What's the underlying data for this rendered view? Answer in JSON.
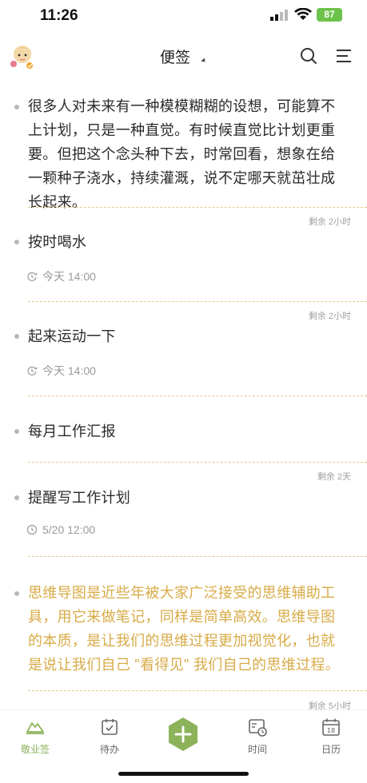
{
  "status_bar": {
    "time": "11:26",
    "battery": "87"
  },
  "header": {
    "title": "便签"
  },
  "notes": [
    {
      "text": "很多人对未来有一种模模糊糊的设想，可能算不上计划，只是一种直觉。有时候直觉比计划更重要。但把这个念头种下去，时常回看，想象在给一颗种子浇水，持续灌溉，说不定哪天就茁壮成长起来。",
      "remain": "剩余 2小时"
    },
    {
      "text": "按时喝水",
      "reminder": "今天 14:00",
      "remain": "剩余 2小时"
    },
    {
      "text": "起来运动一下",
      "reminder": "今天 14:00"
    },
    {
      "text": "每月工作汇报",
      "remain": "剩余 2天"
    },
    {
      "text": "提醒写工作计划",
      "reminder": "5/20 12:00"
    },
    {
      "text": "思维导图是近些年被大家广泛接受的思维辅助工具，用它来做笔记，同样是简单高效。思维导图的本质，是让我们的思维过程更加视觉化，也就是说让我们自己 \"看得见\" 我们自己的思维过程。",
      "remain": "剩余 5小时"
    }
  ],
  "nav": [
    {
      "label": "敬业签",
      "active": true
    },
    {
      "label": "待办"
    },
    {
      "label": "时间"
    },
    {
      "label": "日历",
      "day": "18"
    }
  ],
  "colors": {
    "accent": "#8cb35a",
    "highlight_text": "#d8ab47",
    "divider": "#e2cd8b"
  }
}
